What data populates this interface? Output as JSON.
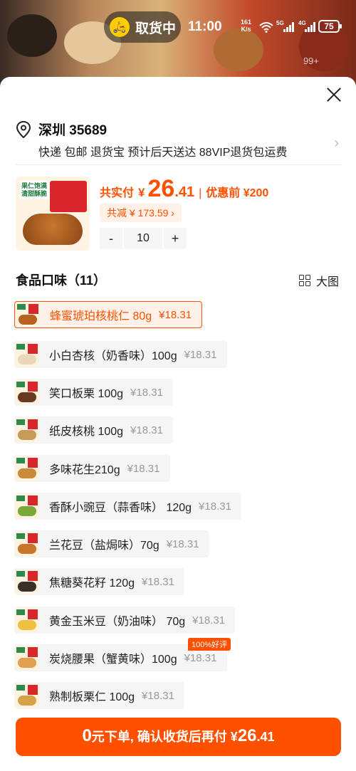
{
  "status_bar": {
    "pill_text": "取货中",
    "rider_icon": "delivery-rider-icon",
    "time": "11:00",
    "net_speed_value": "161",
    "net_speed_unit": "K/s",
    "signal_1_label": "5G",
    "signal_2_label": "4G",
    "battery": "75",
    "background_badge": "99+"
  },
  "address": {
    "title": "深圳 35689",
    "subtitle": "快递 包邮 退货宝 预计后天送达 88VIP退货包运费"
  },
  "product": {
    "price_label": "共实付",
    "currency": "¥",
    "price_int": "26",
    "price_dec": ".41",
    "separator": "|",
    "before_price": "优惠前 ¥200",
    "savings": "共减 ¥ 173.59 ›",
    "image_tag": "果仁饱满 清甜酥脆",
    "quantity": "10",
    "minus": "-",
    "plus": "+"
  },
  "variants_section": {
    "title": "食品口味（11）",
    "big_picture_label": "大图"
  },
  "variants": [
    {
      "name": "蜂蜜琥珀核桃仁 80g",
      "price": "¥18.31",
      "selected": true
    },
    {
      "name": "小白杏核（奶香味）100g",
      "price": "¥18.31",
      "selected": false
    },
    {
      "name": "笑口板栗 100g",
      "price": "¥18.31",
      "selected": false
    },
    {
      "name": "纸皮核桃 100g",
      "price": "¥18.31",
      "selected": false
    },
    {
      "name": "多味花生210g",
      "price": "¥18.31",
      "selected": false
    },
    {
      "name": "香酥小豌豆（蒜香味） 120g",
      "price": "¥18.31",
      "selected": false
    },
    {
      "name": "兰花豆（盐焗味）70g",
      "price": "¥18.31",
      "selected": false
    },
    {
      "name": "焦糖葵花籽 120g",
      "price": "¥18.31",
      "selected": false
    },
    {
      "name": "黄金玉米豆（奶油味） 70g",
      "price": "¥18.31",
      "selected": false
    },
    {
      "name": "炭烧腰果（蟹黄味）100g",
      "price": "¥18.31",
      "selected": false
    },
    {
      "name": "熟制板栗仁 100g",
      "price": "¥18.31",
      "selected": false
    }
  ],
  "good_review_badge": "100%好评",
  "cta": {
    "part1": "0",
    "part2": "元下单, 确认收货后再付 ¥",
    "price_int": "26",
    "price_dec": ".41"
  },
  "colors": {
    "accent": "#ff5000",
    "sheet_bg": "#ffffff",
    "chip_bg": "#f5f5f5"
  }
}
